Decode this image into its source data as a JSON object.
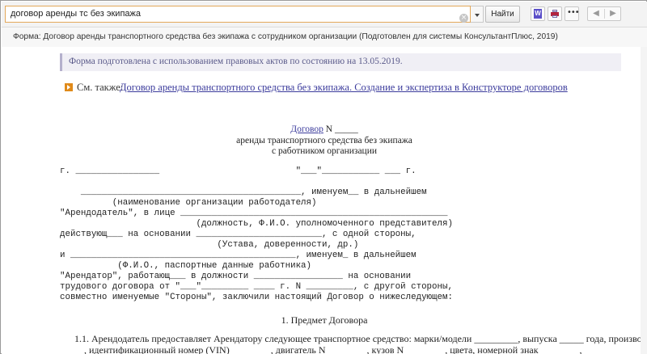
{
  "toolbar": {
    "search_value": "договор аренды тс без экипажа",
    "clear_symbol": "×",
    "find_label": "Найти",
    "word_symbol": "W",
    "more_symbol": "•••",
    "back_symbol": "◀",
    "forward_symbol": "▶"
  },
  "doc_header": "Форма: Договор аренды транспортного средства без экипажа с сотрудником организации (Подготовлен для системы КонсультантПлюс, 2019)",
  "notice": "Форма подготовлена с использованием правовых актов по состоянию на 13.05.2019.",
  "see_also": {
    "label": "См. также:",
    "link": "Договор аренды транспортного средства без экипажа. Создание и экспертиза в Конструкторе договоров"
  },
  "doc_title": {
    "link": "Договор",
    "number": " N _____",
    "line2": "аренды транспортного средства без экипажа",
    "line3": "с работником организации"
  },
  "form_lines": [
    "г. ________________                          \"___\"___________ ___ г.",
    "    __________________________________________, именуем__ в дальнейшем",
    "          (наименование организации работодателя)",
    "\"Арендодатель\", в лице ___________________________________________________",
    "                          (должность, Ф.И.О. уполномоченного представителя)",
    "действующ___ на основании ________________________, с одной стороны,",
    "                              (Устава, доверенности, др.)",
    "и ___________________________________________, именуем_ в дальнейшем",
    "           (Ф.И.О., паспортные данные работника)",
    "\"Арендатор\", работающ___ в должности _________________ на основании",
    "трудового договора от \"___\"_________ ____ г. N _________, с другой стороны,",
    "совместно именуемые \"Стороны\", заключили настоящий Договор о нижеследующем:"
  ],
  "section1_title": "1. Предмет Договора",
  "para_1_1_line1": "1.1. Арендодатель предоставляет Арендатору следующее транспортное средство: марки/модели _________, выпуска _____ года, производства",
  "para_1_1_line2": "    , идентификационный номер (VIN) ________, двигатель N ________, кузов N ________, цвета, номерной знак ________,"
}
